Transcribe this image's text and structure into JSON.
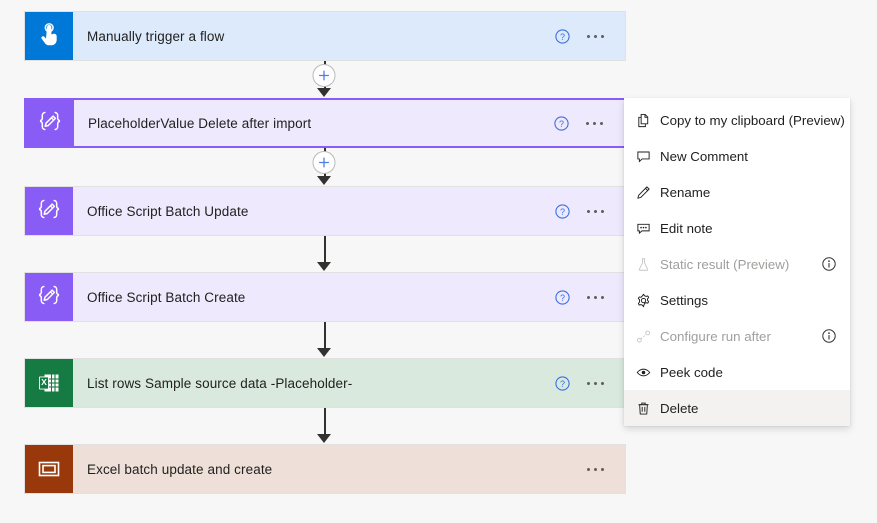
{
  "canvas": {
    "background": "#f7f7f7"
  },
  "flow": {
    "nodes": [
      {
        "title": "Manually trigger a flow",
        "icon": "tap-hand-icon",
        "icon_bg": "#0078d7",
        "body_bg": "#dceafb",
        "has_help": true,
        "has_more": true,
        "selected": false
      },
      {
        "title": "PlaceholderValue Delete after import",
        "icon": "compose-braces-icon",
        "icon_bg": "#8a5cf6",
        "body_bg": "#eee9fd",
        "has_help": true,
        "has_more": true,
        "selected": true
      },
      {
        "title": "Office Script Batch Update",
        "icon": "compose-braces-icon",
        "icon_bg": "#8a5cf6",
        "body_bg": "#eee9fd",
        "has_help": true,
        "has_more": true,
        "selected": false
      },
      {
        "title": "Office Script Batch Create",
        "icon": "compose-braces-icon",
        "icon_bg": "#8a5cf6",
        "body_bg": "#eee9fd",
        "has_help": true,
        "has_more": true,
        "selected": false
      },
      {
        "title": "List rows Sample source data -Placeholder-",
        "icon": "excel-icon",
        "icon_bg": "#157b42",
        "body_bg": "#d9e9dd",
        "has_help": true,
        "has_more": true,
        "selected": false
      },
      {
        "title": "Excel batch update and create",
        "icon": "scope-icon",
        "icon_bg": "#99380b",
        "body_bg": "#eee0d8",
        "has_help": false,
        "has_more": true,
        "selected": false
      }
    ],
    "connectors": [
      {
        "has_plus": true
      },
      {
        "has_plus": true
      },
      {
        "has_plus": false
      },
      {
        "has_plus": false
      },
      {
        "has_plus": false
      }
    ],
    "add_step_label": "+"
  },
  "context_menu": {
    "items": [
      {
        "label": "Copy to my clipboard (Preview)",
        "icon": "copy-icon",
        "disabled": false,
        "has_info": false,
        "hovered": false
      },
      {
        "label": "New Comment",
        "icon": "comment-icon",
        "disabled": false,
        "has_info": false,
        "hovered": false
      },
      {
        "label": "Rename",
        "icon": "pencil-icon",
        "disabled": false,
        "has_info": false,
        "hovered": false
      },
      {
        "label": "Edit note",
        "icon": "note-icon",
        "disabled": false,
        "has_info": false,
        "hovered": false
      },
      {
        "label": "Static result (Preview)",
        "icon": "flask-icon",
        "disabled": true,
        "has_info": true,
        "hovered": false
      },
      {
        "label": "Settings",
        "icon": "gear-icon",
        "disabled": false,
        "has_info": false,
        "hovered": false
      },
      {
        "label": "Configure run after",
        "icon": "run-after-icon",
        "disabled": true,
        "has_info": true,
        "hovered": false
      },
      {
        "label": "Peek code",
        "icon": "eye-icon",
        "disabled": false,
        "has_info": false,
        "hovered": false
      },
      {
        "label": "Delete",
        "icon": "trash-icon",
        "disabled": false,
        "has_info": false,
        "hovered": true
      }
    ]
  }
}
